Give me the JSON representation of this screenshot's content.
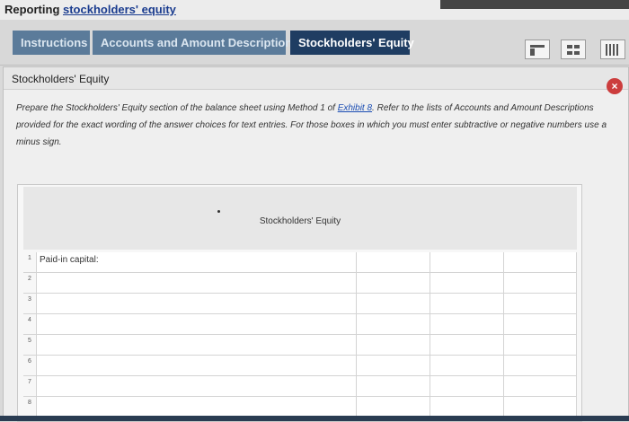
{
  "header": {
    "prefix": "Reporting ",
    "link": "stockholders' equity"
  },
  "tabs": [
    {
      "label": "Instructions"
    },
    {
      "label": "Accounts and Amount Descriptions"
    },
    {
      "label": "Stockholders' Equity"
    }
  ],
  "panel": {
    "title": "Stockholders' Equity",
    "close_label": "×",
    "instructions_before": "Prepare the Stockholders' Equity section of the balance sheet using Method 1 of ",
    "instructions_link": "Exhibit 8",
    "instructions_after": ". Refer to the lists of Accounts and Amount Descriptions provided for the exact wording of the answer choices for text entries. For those boxes in which you must enter subtractive or negative numbers use a minus sign."
  },
  "worksheet": {
    "title": "Stockholders' Equity",
    "rows": [
      {
        "num": "1",
        "label": "Paid-in capital:"
      },
      {
        "num": "2",
        "label": ""
      },
      {
        "num": "3",
        "label": ""
      },
      {
        "num": "4",
        "label": ""
      },
      {
        "num": "5",
        "label": ""
      },
      {
        "num": "6",
        "label": ""
      },
      {
        "num": "7",
        "label": ""
      },
      {
        "num": "8",
        "label": ""
      }
    ]
  },
  "colors": {
    "active_tab": "#1f3d62",
    "inactive_tab": "#5b7b9a",
    "close": "#cc3d3d"
  }
}
